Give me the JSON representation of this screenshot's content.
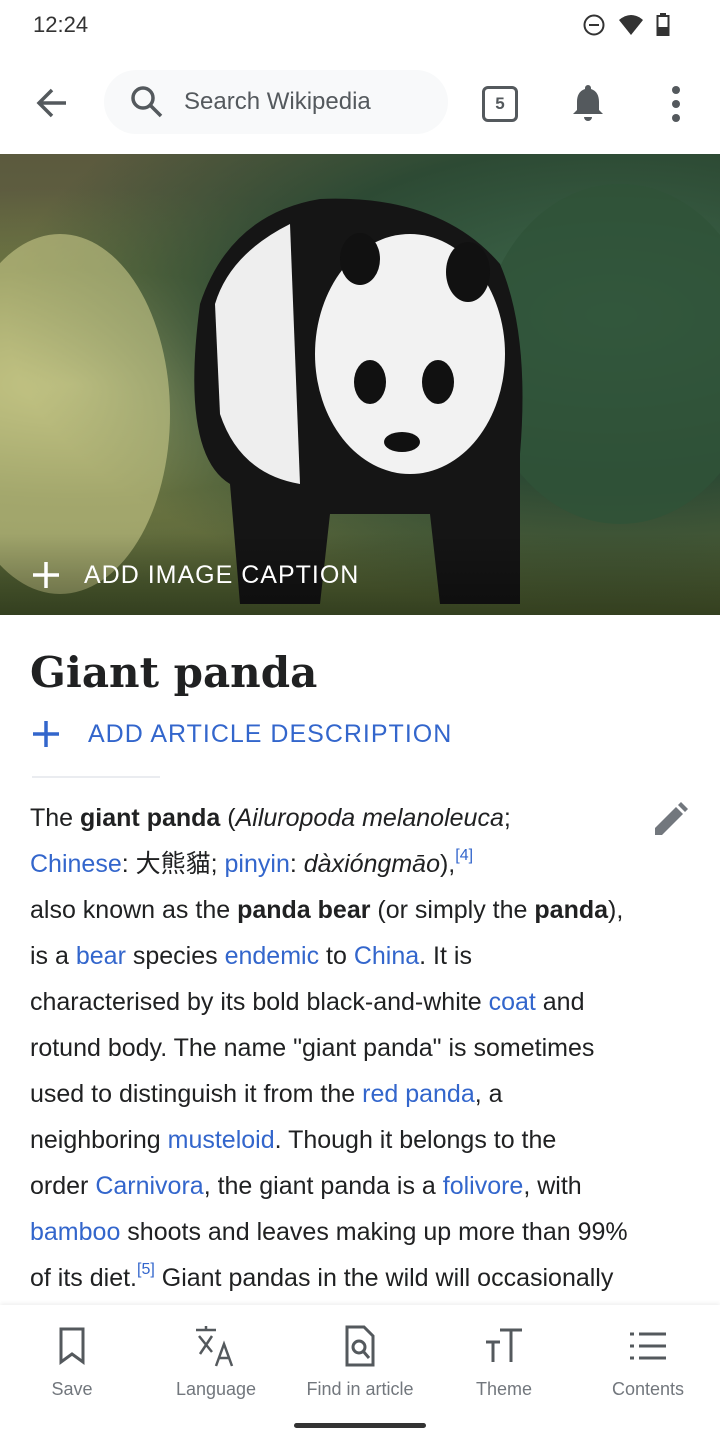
{
  "status": {
    "time": "12:24",
    "icons": [
      "dnd-icon",
      "wifi-icon",
      "battery-icon"
    ]
  },
  "toolbar": {
    "search_placeholder": "Search Wikipedia",
    "tab_count": "5"
  },
  "hero": {
    "caption_action": "ADD IMAGE CAPTION"
  },
  "article": {
    "title": "Giant panda",
    "add_description": "ADD ARTICLE DESCRIPTION",
    "segments": [
      {
        "t": "text",
        "v": "The "
      },
      {
        "t": "b",
        "v": "giant panda"
      },
      {
        "t": "text",
        "v": " ("
      },
      {
        "t": "i",
        "v": "Ailuropoda melanoleuca"
      },
      {
        "t": "text",
        "v": ";"
      },
      {
        "t": "br"
      },
      {
        "t": "a",
        "v": "Chinese"
      },
      {
        "t": "text",
        "v": ": 大熊貓; "
      },
      {
        "t": "a",
        "v": "pinyin"
      },
      {
        "t": "text",
        "v": ": "
      },
      {
        "t": "i",
        "v": "dàxióngmāo"
      },
      {
        "t": "text",
        "v": "),"
      },
      {
        "t": "ref",
        "v": "[4]"
      },
      {
        "t": "br"
      },
      {
        "t": "text",
        "v": "also known as the "
      },
      {
        "t": "b",
        "v": "panda bear"
      },
      {
        "t": "text",
        "v": " (or simply the "
      },
      {
        "t": "b",
        "v": "panda"
      },
      {
        "t": "text",
        "v": "),"
      },
      {
        "t": "br"
      },
      {
        "t": "text",
        "v": "is a "
      },
      {
        "t": "a",
        "v": "bear"
      },
      {
        "t": "text",
        "v": " species "
      },
      {
        "t": "a",
        "v": "endemic"
      },
      {
        "t": "text",
        "v": " to "
      },
      {
        "t": "a",
        "v": "China"
      },
      {
        "t": "text",
        "v": ". It is"
      },
      {
        "t": "br"
      },
      {
        "t": "text",
        "v": "characterised by its bold black-and-white "
      },
      {
        "t": "a",
        "v": "coat"
      },
      {
        "t": "text",
        "v": " and"
      },
      {
        "t": "br"
      },
      {
        "t": "text",
        "v": "rotund body. The name \"giant panda\" is sometimes"
      },
      {
        "t": "br"
      },
      {
        "t": "text",
        "v": "used to distinguish it from the "
      },
      {
        "t": "a",
        "v": "red panda"
      },
      {
        "t": "text",
        "v": ", a"
      },
      {
        "t": "br"
      },
      {
        "t": "text",
        "v": "neighboring "
      },
      {
        "t": "a",
        "v": "musteloid"
      },
      {
        "t": "text",
        "v": ". Though it belongs to the"
      },
      {
        "t": "br"
      },
      {
        "t": "text",
        "v": "order "
      },
      {
        "t": "a",
        "v": "Carnivora"
      },
      {
        "t": "text",
        "v": ", the giant panda is a "
      },
      {
        "t": "a",
        "v": "folivore"
      },
      {
        "t": "text",
        "v": ", with"
      },
      {
        "t": "br"
      },
      {
        "t": "a",
        "v": "bamboo"
      },
      {
        "t": "text",
        "v": " shoots and leaves making up more than 99%"
      },
      {
        "t": "br"
      },
      {
        "t": "text",
        "v": "of its diet."
      },
      {
        "t": "ref",
        "v": "[5]"
      },
      {
        "t": "text",
        "v": " Giant pandas in the wild will occasionally"
      }
    ]
  },
  "bottom_nav": [
    {
      "label": "Save",
      "icon": "bookmark-icon"
    },
    {
      "label": "Language",
      "icon": "translate-icon"
    },
    {
      "label": "Find in article",
      "icon": "find-in-page-icon"
    },
    {
      "label": "Theme",
      "icon": "text-size-icon"
    },
    {
      "label": "Contents",
      "icon": "list-icon"
    }
  ],
  "colors": {
    "link": "#3366cc",
    "text": "#202122",
    "icon": "#54595d"
  }
}
